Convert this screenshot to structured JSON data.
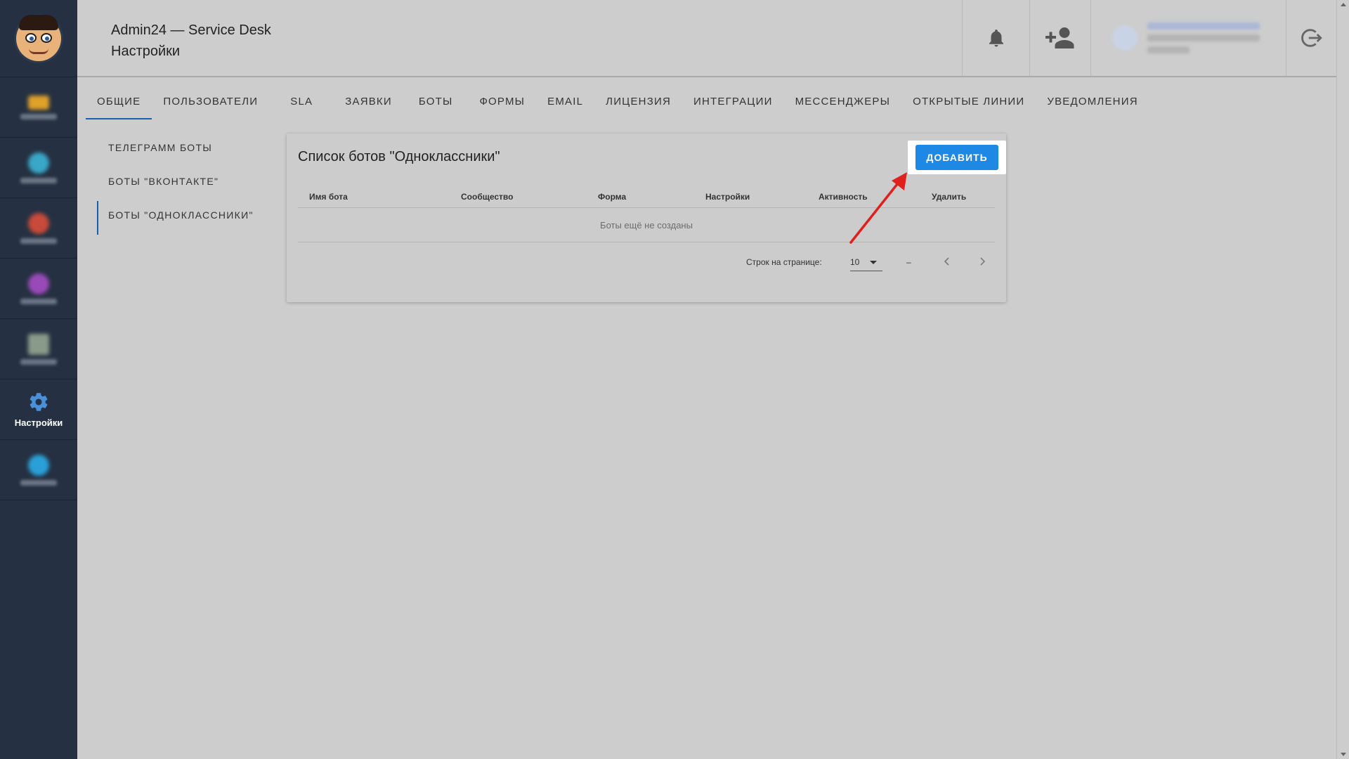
{
  "header": {
    "app_title": "Admin24 — Service Desk",
    "page_title": "Настройки"
  },
  "sidebar": {
    "active_label": "Настройки",
    "items": [
      {
        "icon": "folder-icon",
        "color": "#e0a12a"
      },
      {
        "icon": "chat-icon",
        "color": "#3aa6c8"
      },
      {
        "icon": "puzzle-icon",
        "color": "#c84a3a"
      },
      {
        "icon": "chart-icon",
        "color": "#9a4ab8"
      },
      {
        "icon": "document-icon",
        "color": "#8a9a8a"
      },
      {
        "icon": "gear-icon",
        "color": "#4a90d9"
      },
      {
        "icon": "globe-icon",
        "color": "#2aa0d8"
      }
    ]
  },
  "tabs": [
    {
      "label": "ОБЩИЕ",
      "active": true
    },
    {
      "label": "ПОЛЬЗОВАТЕЛИ"
    },
    {
      "label": "SLA"
    },
    {
      "label": "ЗАЯВКИ"
    },
    {
      "label": "БОТЫ"
    },
    {
      "label": "ФОРМЫ"
    },
    {
      "label": "EMAIL"
    },
    {
      "label": "ЛИЦЕНЗИЯ"
    },
    {
      "label": "ИНТЕГРАЦИИ"
    },
    {
      "label": "МЕССЕНДЖЕРЫ"
    },
    {
      "label": "ОТКРЫТЫЕ ЛИНИИ"
    },
    {
      "label": "УВЕДОМЛЕНИЯ"
    }
  ],
  "subnav": [
    {
      "label": "ТЕЛЕГРАММ БОТЫ"
    },
    {
      "label": "БОТЫ \"ВКОНТАКТЕ\""
    },
    {
      "label": "БОТЫ \"ОДНОКЛАССНИКИ\"",
      "active": true
    }
  ],
  "card": {
    "title": "Список ботов \"Одноклассники\"",
    "add_button": "ДОБАВИТЬ",
    "columns": [
      "Имя бота",
      "Сообщество",
      "Форма",
      "Настройки",
      "Активность",
      "Удалить"
    ],
    "empty_text": "Боты ещё не созданы",
    "rows_per_page_label": "Строк на странице:",
    "rows_per_page_value": "10",
    "range_text": "–"
  },
  "colors": {
    "accent": "#1e88e5",
    "sidebar_bg": "#253142",
    "annotation_arrow": "#e0201c"
  }
}
